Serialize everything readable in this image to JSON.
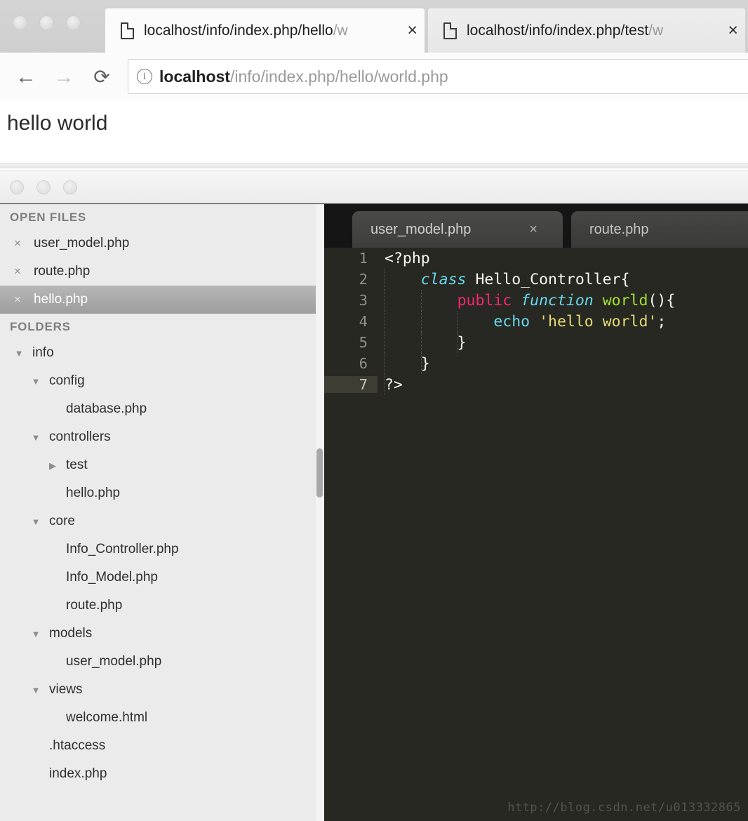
{
  "browser": {
    "traffic_lights": [
      "close",
      "minimize",
      "zoom"
    ],
    "tabs": [
      {
        "title_visible": "localhost/info/index.php/hello",
        "title_faded": "/w",
        "close_label": "×",
        "active": true
      },
      {
        "title_visible": "localhost/info/index.php/test",
        "title_faded": "/w",
        "close_label": "×",
        "active": false
      }
    ],
    "nav": {
      "back_icon": "←",
      "forward_icon": "→",
      "reload_icon": "⟳"
    },
    "omnibox": {
      "site_info_icon": "i",
      "url_host": "localhost",
      "url_path": "/info/index.php/hello/world.php"
    },
    "page": {
      "heading": "hello world"
    }
  },
  "editor": {
    "traffic_lights": [
      "close",
      "minimize",
      "zoom"
    ],
    "sidebar": {
      "open_files_header": "OPEN FILES",
      "open_files": [
        {
          "name": "user_model.php",
          "close_label": "×",
          "selected": false
        },
        {
          "name": "route.php",
          "close_label": "×",
          "selected": false
        },
        {
          "name": "hello.php",
          "close_label": "×",
          "selected": true
        }
      ],
      "folders_header": "FOLDERS",
      "tree": [
        {
          "label": "info",
          "depth": 0,
          "type": "folder",
          "state": "expanded"
        },
        {
          "label": "config",
          "depth": 1,
          "type": "folder",
          "state": "expanded"
        },
        {
          "label": "database.php",
          "depth": 2,
          "type": "file",
          "state": "none"
        },
        {
          "label": "controllers",
          "depth": 1,
          "type": "folder",
          "state": "expanded"
        },
        {
          "label": "test",
          "depth": 2,
          "type": "folder",
          "state": "collapsed"
        },
        {
          "label": "hello.php",
          "depth": 2,
          "type": "file",
          "state": "none"
        },
        {
          "label": "core",
          "depth": 1,
          "type": "folder",
          "state": "expanded"
        },
        {
          "label": "Info_Controller.php",
          "depth": 2,
          "type": "file",
          "state": "none"
        },
        {
          "label": "Info_Model.php",
          "depth": 2,
          "type": "file",
          "state": "none"
        },
        {
          "label": "route.php",
          "depth": 2,
          "type": "file",
          "state": "none"
        },
        {
          "label": "models",
          "depth": 1,
          "type": "folder",
          "state": "expanded"
        },
        {
          "label": "user_model.php",
          "depth": 2,
          "type": "file",
          "state": "none"
        },
        {
          "label": "views",
          "depth": 1,
          "type": "folder",
          "state": "expanded"
        },
        {
          "label": "welcome.html",
          "depth": 2,
          "type": "file",
          "state": "none"
        },
        {
          "label": ".htaccess",
          "depth": 1,
          "type": "file",
          "state": "none"
        },
        {
          "label": "index.php",
          "depth": 1,
          "type": "file",
          "state": "none"
        }
      ],
      "expanded_glyph": "▼",
      "collapsed_glyph": "▶"
    },
    "tabs": [
      {
        "label": "user_model.php",
        "close_label": "×",
        "active": true
      },
      {
        "label": "route.php",
        "close_label": "",
        "active": false
      }
    ],
    "code": {
      "language": "php",
      "current_line": 7,
      "lines": [
        {
          "n": "1",
          "tokens": [
            {
              "t": "<?php",
              "c": "t-white"
            }
          ]
        },
        {
          "n": "2",
          "tokens": [
            {
              "t": "    ",
              "c": "t-white"
            },
            {
              "t": "class",
              "c": "t-cyan"
            },
            {
              "t": " ",
              "c": "t-white"
            },
            {
              "t": "Hello_Controller",
              "c": "t-white"
            },
            {
              "t": "{",
              "c": "t-white"
            }
          ]
        },
        {
          "n": "3",
          "tokens": [
            {
              "t": "        ",
              "c": "t-white"
            },
            {
              "t": "public",
              "c": "t-pink"
            },
            {
              "t": " ",
              "c": "t-white"
            },
            {
              "t": "function",
              "c": "t-cyan"
            },
            {
              "t": " ",
              "c": "t-white"
            },
            {
              "t": "world",
              "c": "t-green"
            },
            {
              "t": "(){",
              "c": "t-white"
            }
          ]
        },
        {
          "n": "4",
          "tokens": [
            {
              "t": "            ",
              "c": "t-white"
            },
            {
              "t": "echo",
              "c": "t-cyan-n"
            },
            {
              "t": " ",
              "c": "t-white"
            },
            {
              "t": "'hello world'",
              "c": "t-str"
            },
            {
              "t": ";",
              "c": "t-white"
            }
          ]
        },
        {
          "n": "5",
          "tokens": [
            {
              "t": "        }",
              "c": "t-white"
            }
          ]
        },
        {
          "n": "6",
          "tokens": [
            {
              "t": "    }",
              "c": "t-white"
            }
          ]
        },
        {
          "n": "7",
          "tokens": [
            {
              "t": "?>",
              "c": "t-white"
            }
          ]
        }
      ]
    },
    "watermark": "http://blog.csdn.net/u013332865"
  },
  "colors": {
    "editor_bg": "#272822",
    "editor_tabbar_bg": "#151515",
    "sidebar_bg": "#ebebeb",
    "keyword_pink": "#f92672",
    "keyword_cyan": "#66d9ef",
    "function_green": "#a6e22e",
    "string_yellow": "#e6db74",
    "text_white": "#f8f8f2",
    "gutter_gray": "#8f908a",
    "current_line_bg": "#3e3d32"
  }
}
